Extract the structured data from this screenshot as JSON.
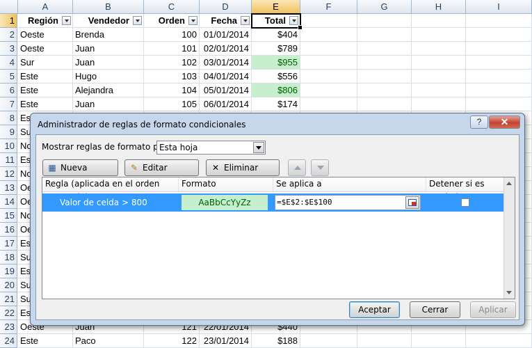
{
  "sheet": {
    "columns": [
      "A",
      "B",
      "C",
      "D",
      "E",
      "F",
      "G",
      "H",
      "I"
    ],
    "selected_column": "E",
    "header_row": [
      "Región",
      "Vendedor",
      "Orden",
      "Fecha",
      "Total"
    ],
    "rows": [
      {
        "n": "1"
      },
      {
        "n": "2",
        "a": "Oeste",
        "b": "Brenda",
        "c": "100",
        "d": "01/01/2014",
        "e": "$404"
      },
      {
        "n": "3",
        "a": "Oeste",
        "b": "Juan",
        "c": "101",
        "d": "02/01/2014",
        "e": "$789"
      },
      {
        "n": "4",
        "a": "Sur",
        "b": "Juan",
        "c": "102",
        "d": "03/01/2014",
        "e": "$955",
        "hi": true
      },
      {
        "n": "5",
        "a": "Este",
        "b": "Hugo",
        "c": "103",
        "d": "04/01/2014",
        "e": "$556"
      },
      {
        "n": "6",
        "a": "Este",
        "b": "Alejandra",
        "c": "104",
        "d": "05/01/2014",
        "e": "$806",
        "hi": true
      },
      {
        "n": "7",
        "a": "Este",
        "b": "Juan",
        "c": "105",
        "d": "06/01/2014",
        "e": "$174"
      },
      {
        "n": "8",
        "a": "Est"
      },
      {
        "n": "9",
        "a": "Su"
      },
      {
        "n": "10",
        "a": "No"
      },
      {
        "n": "11",
        "a": "Est"
      },
      {
        "n": "12",
        "a": "No"
      },
      {
        "n": "13",
        "a": "Oe"
      },
      {
        "n": "14",
        "a": "Oe"
      },
      {
        "n": "15",
        "a": "No"
      },
      {
        "n": "16",
        "a": "Oe"
      },
      {
        "n": "17",
        "a": "Est"
      },
      {
        "n": "18",
        "a": "Su"
      },
      {
        "n": "19",
        "a": "Est"
      },
      {
        "n": "20",
        "a": "Su"
      },
      {
        "n": "21",
        "a": "Su"
      },
      {
        "n": "22",
        "a": "Est"
      },
      {
        "n": "23",
        "a": "Oeste",
        "b": "Juan",
        "c": "121",
        "d": "22/01/2014",
        "e": "$440"
      },
      {
        "n": "24",
        "a": "Este",
        "b": "Paco",
        "c": "122",
        "d": "23/01/2014",
        "e": "$188"
      }
    ]
  },
  "dialog": {
    "title": "Administrador de reglas de formato condicionales",
    "help_label": "?",
    "show_rules_label": "Mostrar reglas de formato para:",
    "show_rules_value": "Esta hoja",
    "new_rule": "Nueva regla...",
    "edit_rule": "Editar regla...",
    "delete_rule": "Eliminar regla",
    "list_headers": {
      "rule": "Regla (aplicada en el orden mostrado)",
      "format": "Formato",
      "applies_to": "Se aplica a",
      "stop_if_true": "Detener si es verdad"
    },
    "rule": {
      "condition": "Valor de celda > 800",
      "preview": "AaBbCcYyZz",
      "range": "=$E$2:$E$100",
      "stop_if_true": false
    },
    "ok": "Aceptar",
    "close": "Cerrar",
    "apply": "Aplicar"
  },
  "colors": {
    "highlight_fill": "#c6efce",
    "highlight_text": "#006100",
    "selection_blue": "#3399ff",
    "close_red": "#c4412e"
  }
}
